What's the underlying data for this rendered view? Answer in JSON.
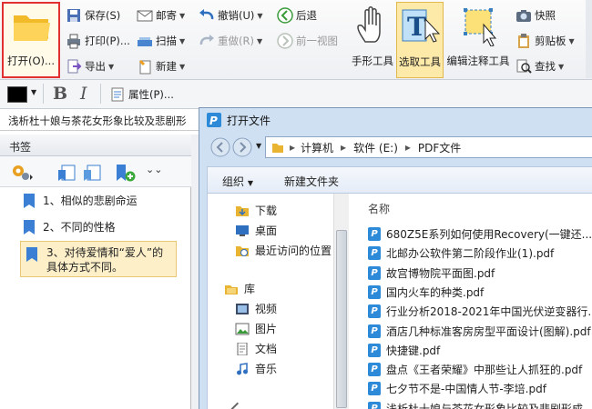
{
  "ribbon": {
    "open_label": "打开(O)...",
    "save": "保存(S)",
    "print": "打印(P)...",
    "export": "导出",
    "mail": "邮寄",
    "scan": "扫描",
    "new": "新建",
    "undo": "撤销(U)",
    "redo": "重做(R)",
    "back": "后退",
    "forward": "前一视图",
    "hand_tool": "手形工具",
    "select_tool": "选取工具",
    "edit_annot_tool": "编辑注释工具",
    "snapshot": "快照",
    "clipboard": "剪贴板",
    "find": "查找"
  },
  "format_bar": {
    "bold": "B",
    "italic": "I",
    "properties": "属性(P)..."
  },
  "doc_tab": {
    "title": "浅析杜十娘与茶花女形象比较及悲剧形"
  },
  "bookmarks": {
    "header": "书签",
    "items": [
      {
        "label": "1、相似的悲剧命运",
        "selected": false
      },
      {
        "label": "2、不同的性格",
        "selected": false
      },
      {
        "label_line1": "3、对待爱情和“爱人”的",
        "label_line2": "具体方式不同。",
        "selected": true
      }
    ]
  },
  "dialog": {
    "title": "打开文件",
    "breadcrumb": [
      "计算机",
      "软件 (E:)",
      "PDF文件"
    ],
    "organize": "组织",
    "new_folder": "新建文件夹",
    "nav_items": [
      "下载",
      "桌面",
      "最近访问的位置"
    ],
    "library_header": "库",
    "library_items": [
      "视频",
      "图片",
      "文档",
      "音乐"
    ],
    "column_name": "名称",
    "files": [
      "680Z5E系列如何使用Recovery(一键还...",
      "北邮办公软件第二阶段作业(1).pdf",
      "故宫博物院平面图.pdf",
      "国内火车的种类.pdf",
      "行业分析2018-2021年中国光伏逆变器行...",
      "酒店几种标准客房房型平面设计(图解).pdf",
      "快捷键.pdf",
      "盘点《王者荣耀》中那些让人抓狂的.pdf",
      "七夕节不是-中国情人节-李培.pdf",
      "浅析杜十娘与茶花女形象比较及悲剧形成..."
    ]
  },
  "colors": {
    "accent": "#2d8ad8",
    "highlight": "#e03030",
    "selected_bg": "#fde9a8"
  }
}
